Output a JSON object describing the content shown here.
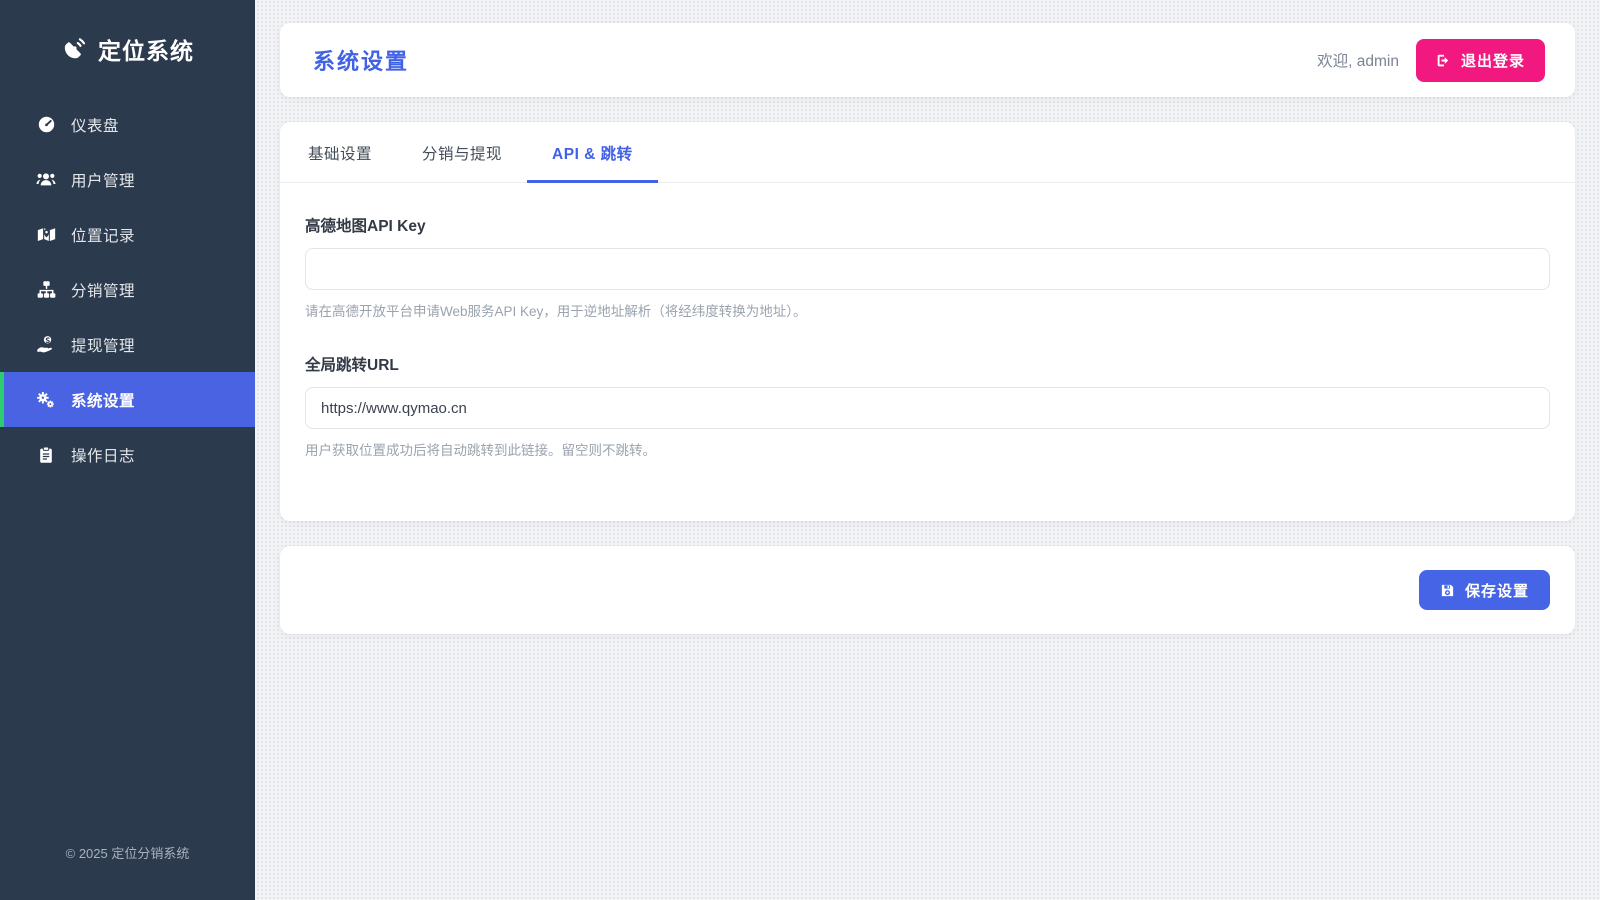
{
  "app": {
    "name": "定位系统",
    "footer": "© 2025 定位分销系统"
  },
  "header": {
    "title": "系统设置",
    "welcome": "欢迎, admin",
    "logout_label": "退出登录"
  },
  "sidebar": {
    "items": [
      {
        "label": "仪表盘",
        "icon": "gauge-icon",
        "active": false
      },
      {
        "label": "用户管理",
        "icon": "users-icon",
        "active": false
      },
      {
        "label": "位置记录",
        "icon": "map-location-icon",
        "active": false
      },
      {
        "label": "分销管理",
        "icon": "sitemap-icon",
        "active": false
      },
      {
        "label": "提现管理",
        "icon": "hand-holding-dollar-icon",
        "active": false
      },
      {
        "label": "系统设置",
        "icon": "gears-icon",
        "active": true
      },
      {
        "label": "操作日志",
        "icon": "clipboard-list-icon",
        "active": false
      }
    ]
  },
  "tabs": [
    {
      "label": "基础设置",
      "active": false
    },
    {
      "label": "分销与提现",
      "active": false
    },
    {
      "label": "API & 跳转",
      "active": true
    }
  ],
  "form": {
    "fields": [
      {
        "label": "高德地图API Key",
        "value": "",
        "help": "请在高德开放平台申请Web服务API Key，用于逆地址解析（将经纬度转换为地址）。"
      },
      {
        "label": "全局跳转URL",
        "value": "https://www.qymao.cn",
        "help": "用户获取位置成功后将自动跳转到此链接。留空则不跳转。"
      }
    ],
    "save_label": "保存设置"
  },
  "colors": {
    "sidebar_bg": "#2c3a4d",
    "primary_blue": "#4565e6",
    "active_item_blue": "#4a63e2",
    "title_blue": "#4161e6",
    "accent_green": "#2ecc71",
    "logout_pink": "#f1197f",
    "page_bg": "#f3f4f6"
  }
}
